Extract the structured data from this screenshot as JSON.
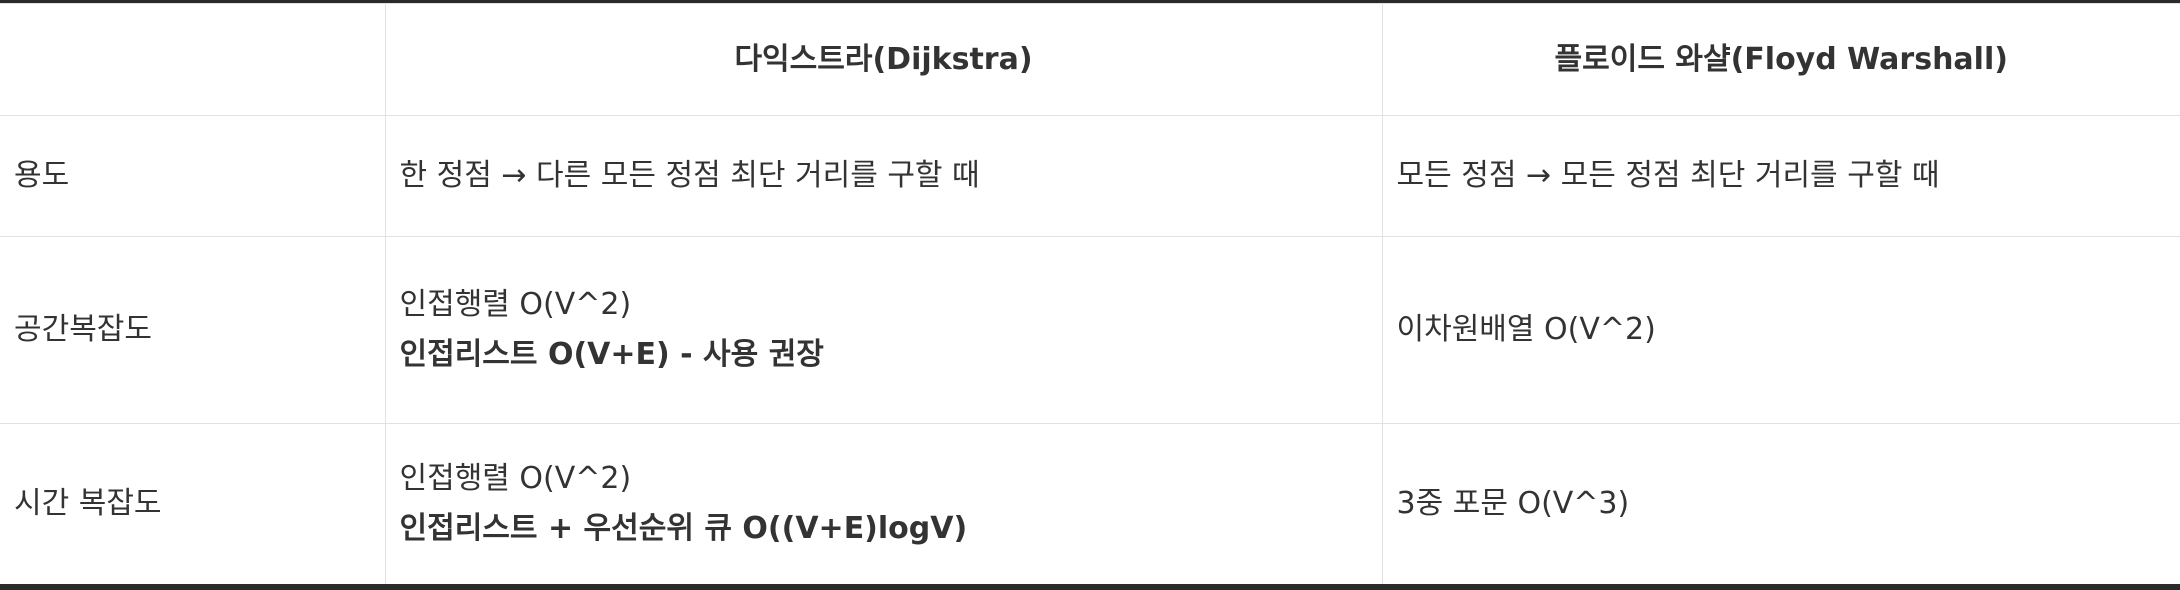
{
  "table": {
    "headers": [
      "",
      "다익스트라(Dijkstra)",
      "플로이드 와샬(Floyd Warshall)"
    ],
    "rows": [
      {
        "label": "용도",
        "dijkstra": [
          "한 정점 → 다른 모든 정점 최단 거리를 구할 때"
        ],
        "floyd": [
          "모든 정점 → 모든 정점 최단 거리를 구할 때"
        ]
      },
      {
        "label": "공간복잡도",
        "dijkstra": [
          "인접행렬 O(V^2)",
          "인접리스트 O(V+E) - 사용 권장"
        ],
        "floyd": [
          "이차원배열 O(V^2)"
        ]
      },
      {
        "label": "시간 복잡도",
        "dijkstra": [
          "인접행렬 O(V^2)",
          "인접리스트 + 우선순위 큐 O((V+E)logV)"
        ],
        "floyd": [
          "3중 포문 O(V^3)"
        ]
      }
    ]
  }
}
